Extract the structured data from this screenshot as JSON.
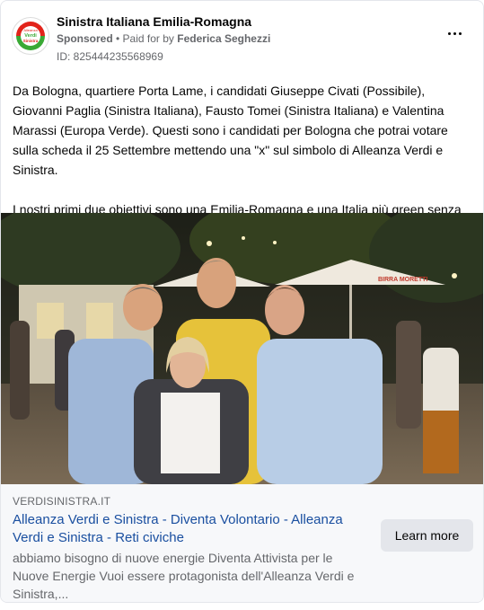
{
  "ad": {
    "page_name": "Sinistra Italiana Emilia-Romagna",
    "sponsored": "Sponsored",
    "separator": " • ",
    "paid_for_by": "Paid for by",
    "payer": "Federica Seghezzi",
    "ad_id": "ID: 825444235568969",
    "avatar_logo_lines": [
      "Alleanza",
      "Verdi",
      "Sinistra"
    ],
    "more_icon": "more-horizontal-icon"
  },
  "body": {
    "paragraph_1": "Da Bologna, quartiere Porta Lame, i candidati Giuseppe Civati (Possibile), Giovanni Paglia (Sinistra Italiana), Fausto Tomei (Sinistra Italiana) e Valentina Marassi (Europa Verde). Questi sono i candidati per Bologna che potrai votare sulla scheda il 25 Settembre mettendo una \"x\" sul simbolo di Alleanza Verdi e Sinistra.",
    "paragraph_2": "I nostri primi due obiettivi sono una Emilia-Romagna e una Italia più green senza emergenza climatica e creare lavoro di qualità senza sfruttamento...."
  },
  "photo": {
    "umbrella_brand": "BIRRA MORETTI"
  },
  "link": {
    "domain": "VERDISINISTRA.IT",
    "title": "Alleanza Verdi e Sinistra - Diventa Volontario - Alleanza Verdi e Sinistra - Reti civiche",
    "description": "abbiamo bisogno di nuove energie Diventa Attivista per le Nuove Energie Vuoi essere protagonista dell'Alleanza Verdi e Sinistra,...",
    "cta_label": "Learn more"
  },
  "colors": {
    "link_title": "#1a4fa0",
    "secondary_text": "#65676b",
    "button_bg": "#e4e6eb",
    "logo_green": "#3aa935",
    "logo_red": "#e2231a"
  }
}
